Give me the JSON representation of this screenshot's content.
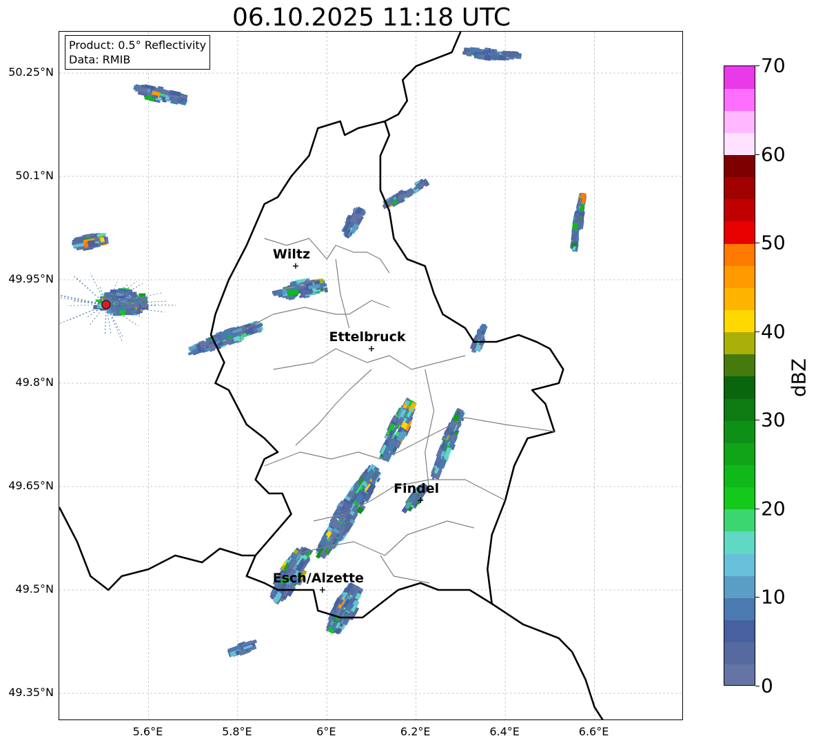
{
  "title": "06.10.2025 11:18 UTC",
  "info": {
    "product": "Product: 0.5° Reflectivity",
    "data": "Data: RMIB"
  },
  "map": {
    "lon_range": [
      5.4,
      6.8
    ],
    "lat_range": [
      49.31,
      50.31
    ],
    "lat_ticks": [
      {
        "value": 50.25,
        "label": "50.25°N"
      },
      {
        "value": 50.1,
        "label": "50.1°N"
      },
      {
        "value": 49.95,
        "label": "49.95°N"
      },
      {
        "value": 49.8,
        "label": "49.8°N"
      },
      {
        "value": 49.65,
        "label": "49.65°N"
      },
      {
        "value": 49.5,
        "label": "49.5°N"
      },
      {
        "value": 49.35,
        "label": "49.35°N"
      }
    ],
    "lon_ticks": [
      {
        "value": 5.6,
        "label": "5.6°E"
      },
      {
        "value": 5.8,
        "label": "5.8°E"
      },
      {
        "value": 6.0,
        "label": "6°E"
      },
      {
        "value": 6.2,
        "label": "6.2°E"
      },
      {
        "value": 6.4,
        "label": "6.4°E"
      },
      {
        "value": 6.6,
        "label": "6.6°E"
      }
    ],
    "cities": [
      {
        "name": "Wiltz",
        "lon": 5.93,
        "lat": 49.97
      },
      {
        "name": "Ettelbruck",
        "lon": 6.1,
        "lat": 49.85
      },
      {
        "name": "Findel",
        "lon": 6.21,
        "lat": 49.63
      },
      {
        "name": "Esch/Alzette",
        "lon": 5.99,
        "lat": 49.5
      }
    ],
    "radar_site": {
      "lon": 5.505,
      "lat": 49.914
    },
    "radar_cells": [
      {
        "lon": 6.05,
        "lat": 49.62,
        "len": 0.22,
        "wid": 0.05,
        "angle": 58,
        "n": 260
      },
      {
        "lon": 6.16,
        "lat": 49.74,
        "len": 0.13,
        "wid": 0.04,
        "angle": 65,
        "n": 160
      },
      {
        "lon": 6.27,
        "lat": 49.72,
        "len": 0.15,
        "wid": 0.025,
        "angle": 68,
        "n": 120
      },
      {
        "lon": 5.92,
        "lat": 49.53,
        "len": 0.12,
        "wid": 0.05,
        "angle": 60,
        "n": 200
      },
      {
        "lon": 6.04,
        "lat": 49.48,
        "len": 0.1,
        "wid": 0.05,
        "angle": 62,
        "n": 180
      },
      {
        "lon": 6.2,
        "lat": 49.64,
        "len": 0.06,
        "wid": 0.02,
        "angle": 55,
        "n": 60
      },
      {
        "lon": 5.78,
        "lat": 49.87,
        "len": 0.16,
        "wid": 0.03,
        "angle": 20,
        "n": 170
      },
      {
        "lon": 5.55,
        "lat": 49.92,
        "len": 0.1,
        "wid": 0.06,
        "angle": 0,
        "n": 160
      },
      {
        "lon": 5.48,
        "lat": 50.01,
        "len": 0.06,
        "wid": 0.03,
        "angle": 10,
        "n": 70
      },
      {
        "lon": 5.64,
        "lat": 50.22,
        "len": 0.1,
        "wid": 0.03,
        "angle": -12,
        "n": 120
      },
      {
        "lon": 6.56,
        "lat": 50.04,
        "len": 0.12,
        "wid": 0.015,
        "angle": 80,
        "n": 90
      },
      {
        "lon": 6.18,
        "lat": 50.08,
        "len": 0.1,
        "wid": 0.02,
        "angle": 30,
        "n": 60
      },
      {
        "lon": 6.38,
        "lat": 50.28,
        "len": 0.12,
        "wid": 0.02,
        "angle": -5,
        "n": 70
      },
      {
        "lon": 5.95,
        "lat": 49.94,
        "len": 0.1,
        "wid": 0.04,
        "angle": 10,
        "n": 90
      },
      {
        "lon": 6.06,
        "lat": 50.04,
        "len": 0.06,
        "wid": 0.03,
        "angle": 60,
        "n": 60
      },
      {
        "lon": 6.34,
        "lat": 49.87,
        "len": 0.06,
        "wid": 0.02,
        "angle": 70,
        "n": 40
      },
      {
        "lon": 5.82,
        "lat": 49.42,
        "len": 0.05,
        "wid": 0.02,
        "angle": 20,
        "n": 30
      }
    ]
  },
  "colorbar": {
    "label": "dBZ",
    "min": 0,
    "max": 70,
    "ticks": [
      0,
      10,
      20,
      30,
      40,
      50,
      60,
      70
    ],
    "colors": [
      "#6474a4",
      "#566aa0",
      "#4860a0",
      "#4a7ab0",
      "#5a9ec6",
      "#66c0da",
      "#60d8c4",
      "#3cd670",
      "#14c81c",
      "#10b81a",
      "#10a418",
      "#0e9016",
      "#0c7c12",
      "#0a660e",
      "#467a0e",
      "#aab008",
      "#ffd800",
      "#ffb400",
      "#ff9a00",
      "#ff7a00",
      "#e80000",
      "#c00000",
      "#a00000",
      "#7e0000",
      "#ffe2ff",
      "#ffb8ff",
      "#ff6eff",
      "#e83ae8"
    ]
  }
}
